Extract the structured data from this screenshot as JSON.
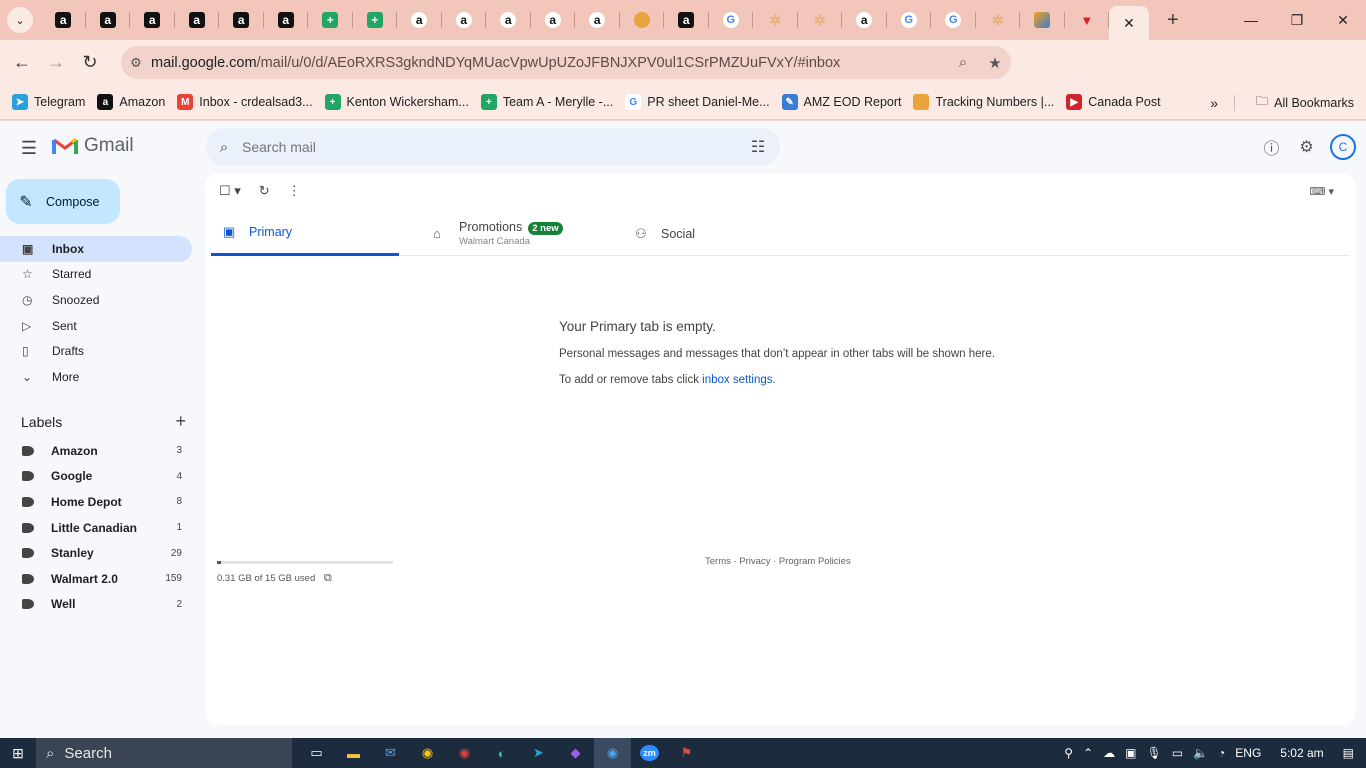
{
  "browser": {
    "tabs": [
      {
        "icon": "amazon-icon",
        "glyph": "a",
        "style": "amazon"
      },
      {
        "icon": "amazon-icon",
        "glyph": "a",
        "style": "amazon"
      },
      {
        "icon": "amazon-icon",
        "glyph": "a",
        "style": "amazon"
      },
      {
        "icon": "amazon-icon",
        "glyph": "a",
        "style": "amazon"
      },
      {
        "icon": "amazon-icon",
        "glyph": "a",
        "style": "amazon"
      },
      {
        "icon": "amazon-icon",
        "glyph": "a",
        "style": "amazon"
      },
      {
        "icon": "sheets-icon",
        "glyph": "+",
        "style": "sheet"
      },
      {
        "icon": "sheets-icon",
        "glyph": "+",
        "style": "sheet"
      },
      {
        "icon": "amazon-smile-icon",
        "glyph": "a",
        "style": "amz2"
      },
      {
        "icon": "amazon-smile-icon",
        "glyph": "a",
        "style": "amz2"
      },
      {
        "icon": "amazon-smile-icon",
        "glyph": "a",
        "style": "amz2"
      },
      {
        "icon": "amazon-smile-icon",
        "glyph": "a",
        "style": "amz2"
      },
      {
        "icon": "amazon-smile-icon",
        "glyph": "a",
        "style": "amz2"
      },
      {
        "icon": "taco-icon",
        "glyph": "",
        "style": "taco"
      },
      {
        "icon": "amazon-icon",
        "glyph": "a",
        "style": "amazon"
      },
      {
        "icon": "google-icon",
        "glyph": "G",
        "style": "google"
      },
      {
        "icon": "star-icon",
        "glyph": "✲",
        "style": "star"
      },
      {
        "icon": "star-icon",
        "glyph": "✲",
        "style": "star"
      },
      {
        "icon": "amazon-smile-icon",
        "glyph": "a",
        "style": "amz2"
      },
      {
        "icon": "google-icon",
        "glyph": "G",
        "style": "google"
      },
      {
        "icon": "google-icon",
        "glyph": "G",
        "style": "google"
      },
      {
        "icon": "star-icon",
        "glyph": "✲",
        "style": "star"
      },
      {
        "icon": "brush-icon",
        "glyph": "",
        "style": "brush"
      },
      {
        "icon": "canada-post-icon",
        "glyph": "▼",
        "style": "can"
      }
    ],
    "url_host": "mail.google.com",
    "url_path": "/mail/u/0/d/AEoRXRS3gkndNDYqMUacVpwUpUZoJFBNJXPV0ul1CSrPMZUuFVxY/#inbox",
    "bookmarks": [
      {
        "label": "Telegram",
        "color": "#2aa1da",
        "glyph": "➤"
      },
      {
        "label": "Amazon",
        "color": "#111111",
        "glyph": "a"
      },
      {
        "label": "Inbox - crdealsad3...",
        "color": "#ea4335",
        "glyph": "M"
      },
      {
        "label": "Kenton Wickersham...",
        "color": "#23a566",
        "glyph": "+"
      },
      {
        "label": "Team A - Merylle -...",
        "color": "#23a566",
        "glyph": "+"
      },
      {
        "label": "PR sheet Daniel-Me...",
        "color": "#ffffff",
        "glyph": "G"
      },
      {
        "label": "AMZ EOD Report",
        "color": "#3a7bd5",
        "glyph": "✎"
      },
      {
        "label": "Tracking Numbers |...",
        "color": "#e8a33c",
        "glyph": ""
      },
      {
        "label": "Canada Post",
        "color": "#d0232a",
        "glyph": "▶"
      }
    ],
    "all_bookmarks": "All Bookmarks"
  },
  "gmail": {
    "brand": "Gmail",
    "search_placeholder": "Search mail",
    "compose": "Compose",
    "nav": [
      {
        "label": "Inbox",
        "icon": "inbox-icon",
        "glyph": "▣",
        "active": true
      },
      {
        "label": "Starred",
        "icon": "star-outline-icon",
        "glyph": "☆",
        "active": false
      },
      {
        "label": "Snoozed",
        "icon": "clock-icon",
        "glyph": "◷",
        "active": false
      },
      {
        "label": "Sent",
        "icon": "send-icon",
        "glyph": "▷",
        "active": false
      },
      {
        "label": "Drafts",
        "icon": "draft-icon",
        "glyph": "▯",
        "active": false
      },
      {
        "label": "More",
        "icon": "chevron-down-icon",
        "glyph": "⌄",
        "active": false
      }
    ],
    "labels_heading": "Labels",
    "labels": [
      {
        "name": "Amazon",
        "count": "3"
      },
      {
        "name": "Google",
        "count": "4"
      },
      {
        "name": "Home Depot",
        "count": "8"
      },
      {
        "name": "Little Canadian",
        "count": "1"
      },
      {
        "name": "Stanley",
        "count": "29"
      },
      {
        "name": "Walmart 2.0",
        "count": "159"
      },
      {
        "name": "Well",
        "count": "2"
      }
    ],
    "tabs": {
      "primary": "Primary",
      "promotions": "Promotions",
      "promotions_badge": "2 new",
      "promotions_sub": "Walmart Canada",
      "social": "Social"
    },
    "empty": {
      "title": "Your Primary tab is empty.",
      "line1": "Personal messages and messages that don’t appear in other tabs will be shown here.",
      "line2_prefix": "To add or remove tabs click ",
      "line2_link": "inbox settings",
      "line2_suffix": "."
    },
    "storage": {
      "text": "0.31 GB of 15 GB used",
      "fraction": 0.02
    },
    "footer": "Terms · Privacy · Program Policies",
    "avatar_letter": "C"
  },
  "taskbar": {
    "search": "Search",
    "lang": "ENG",
    "time": "5:02 am"
  }
}
